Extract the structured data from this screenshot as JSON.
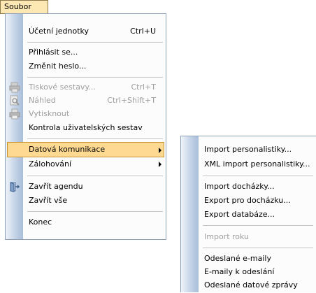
{
  "menubar": {
    "soubor": "Soubor"
  },
  "main_menu": {
    "ucetni_jednotky": "Účetní jednotky",
    "ucetni_jednotky_sc": "Ctrl+U",
    "prihlasit": "Přihlásit se...",
    "zmenit_heslo": "Změnit heslo...",
    "tiskove_sestavy": "Tiskové sestavy...",
    "tiskove_sestavy_sc": "Ctrl+T",
    "nahled": "Náhled",
    "nahled_sc": "Ctrl+Shift+T",
    "vytisknout": "Vytisknout",
    "kontrola": "Kontrola uživatelských sestav",
    "datova_komunikace": "Datová komunikace",
    "zalohovani": "Zálohování",
    "zavrit_agendu": "Zavřít agendu",
    "zavrit_vse": "Zavřít vše",
    "konec": "Konec"
  },
  "sub_menu": {
    "import_personalistiky": "Import personalistiky...",
    "xml_import": "XML import personalistiky...",
    "import_dochazky": "Import docházky...",
    "export_dochazku": "Export pro docházku...",
    "export_databaze": "Export databáze...",
    "import_roku": "Import roku",
    "odeslane_emaily": "Odeslané e-maily",
    "emaily_k_odeslani": "E-maily k odeslání",
    "odeslane_datove": "Odeslané datové zprávy"
  }
}
